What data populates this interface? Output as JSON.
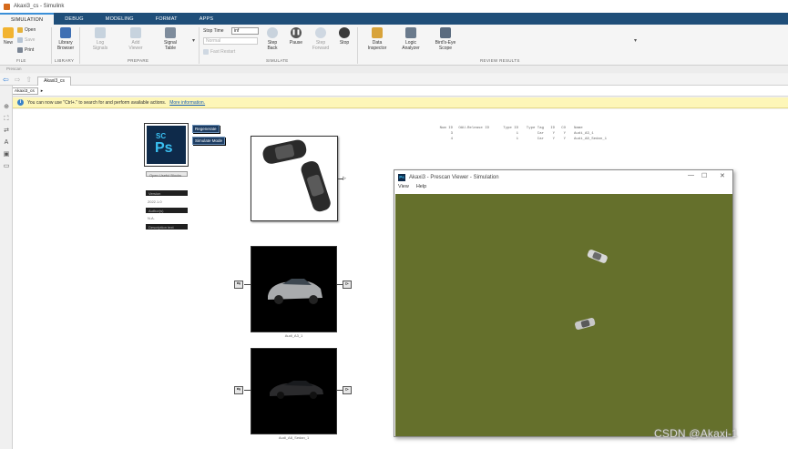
{
  "window": {
    "title": "Akaxi3_cs - Simulink"
  },
  "tabs": [
    {
      "label": "SIMULATION",
      "active": true
    },
    {
      "label": "DEBUG"
    },
    {
      "label": "MODELING"
    },
    {
      "label": "FORMAT"
    },
    {
      "label": "APPS"
    }
  ],
  "ribbon": {
    "file": {
      "new": "New",
      "open": "Open",
      "save": "Save",
      "print": "Print",
      "group": "FILE"
    },
    "library": {
      "browser_line1": "Library",
      "browser_line2": "Browser",
      "group": "LIBRARY"
    },
    "prepare": {
      "log_line1": "Log",
      "log_line2": "Signals",
      "add_line1": "Add",
      "add_line2": "Viewer",
      "signal_line1": "Signal",
      "signal_line2": "Table",
      "group": "PREPARE"
    },
    "simulate": {
      "stop_time_label": "Stop Time",
      "stop_time_value": "inf",
      "mode": "Normal",
      "fast_restart": "Fast Restart",
      "step_back_line1": "Step",
      "step_back_line2": "Back",
      "pause": "Pause",
      "step_fwd_line1": "Step",
      "step_fwd_line2": "Forward",
      "stop": "Stop",
      "group": "SIMULATE"
    },
    "review": {
      "data_line1": "Data",
      "data_line2": "Inspector",
      "logic_line1": "Logic",
      "logic_line2": "Analyzer",
      "birds_line1": "Bird's-Eye",
      "birds_line2": "Scope",
      "group": "REVIEW RESULTS"
    }
  },
  "strip_text": "Prescan",
  "model_tab": "Akaxi3_cs",
  "breadcrumb": "Akaxi3_cs",
  "infobar": {
    "message": "You can now use \"Ctrl+.\" to search for and perform available actions.",
    "link": "More information."
  },
  "ps_block": {
    "sc": "SC",
    "ps": "Ps",
    "btn_regenerate": "Regenerate",
    "btn_simulate": "Simulate Mode",
    "open_label": "Open Useful Blocks",
    "version_label": "Version",
    "version_value": "2022.1.0",
    "author_label": "Author(s)",
    "author_value": "N.A.",
    "desc_label": "Description text"
  },
  "vehicles": [
    {
      "caption": "Audi_A3_1",
      "port_in": "⇆",
      "port_out": "⊳"
    },
    {
      "caption": "Audi_A8_Sedan_1",
      "port_in": "⇆",
      "port_out": "⊳"
    }
  ],
  "table": {
    "headers": [
      "Num ID",
      "OAU-Release ID",
      "Type ID",
      "Type Tag",
      "ID",
      "CO",
      "Name"
    ],
    "rows": [
      [
        "3",
        "",
        "1",
        "Car",
        "Y",
        "Y",
        "Audi_A3_1"
      ],
      [
        "4",
        "",
        "1",
        "Car",
        "Y",
        "Y",
        "Audi_A8_Sedan_1"
      ]
    ]
  },
  "viewer": {
    "title": "Akaxi3 - Prescan Viewer - Simulation",
    "icon": "Ps",
    "menu": [
      "View",
      "Help"
    ],
    "ground_color": "#65702c"
  },
  "watermark": "CSDN @Akaxi-1",
  "colors": {
    "tabstrip": "#1f4e79",
    "accent": "#3a8fd8"
  }
}
